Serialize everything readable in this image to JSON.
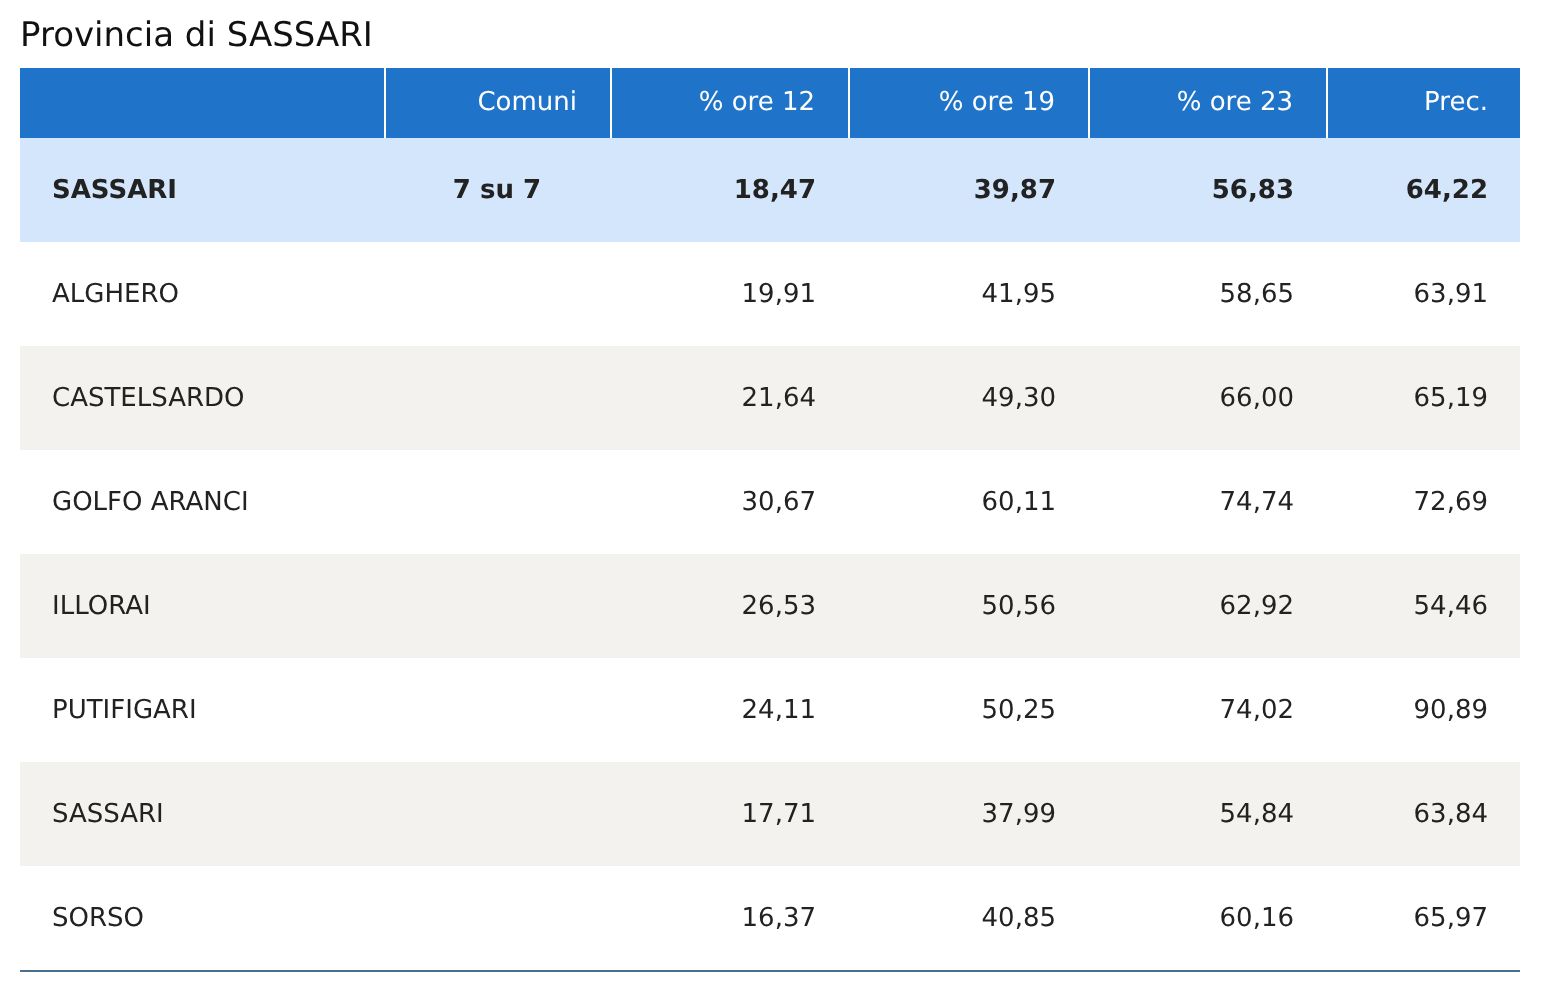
{
  "title": "Provincia di SASSARI",
  "table": {
    "columns": [
      "",
      "Comuni",
      "% ore 12",
      "% ore 19",
      "% ore 23",
      "Prec."
    ],
    "rows": [
      {
        "kind": "total",
        "cells": [
          "SASSARI",
          "7 su 7",
          "18,47",
          "39,87",
          "56,83",
          "64,22"
        ]
      },
      {
        "kind": "commune",
        "cells": [
          "ALGHERO",
          "",
          "19,91",
          "41,95",
          "58,65",
          "63,91"
        ]
      },
      {
        "kind": "commune",
        "cells": [
          "CASTELSARDO",
          "",
          "21,64",
          "49,30",
          "66,00",
          "65,19"
        ]
      },
      {
        "kind": "commune",
        "cells": [
          "GOLFO ARANCI",
          "",
          "30,67",
          "60,11",
          "74,74",
          "72,69"
        ]
      },
      {
        "kind": "commune",
        "cells": [
          "ILLORAI",
          "",
          "26,53",
          "50,56",
          "62,92",
          "54,46"
        ]
      },
      {
        "kind": "commune",
        "cells": [
          "PUTIFIGARI",
          "",
          "24,11",
          "50,25",
          "74,02",
          "90,89"
        ]
      },
      {
        "kind": "commune",
        "cells": [
          "SASSARI",
          "",
          "17,71",
          "37,99",
          "54,84",
          "63,84"
        ]
      },
      {
        "kind": "commune",
        "cells": [
          "SORSO",
          "",
          "16,37",
          "40,85",
          "60,16",
          "65,97"
        ]
      }
    ]
  }
}
